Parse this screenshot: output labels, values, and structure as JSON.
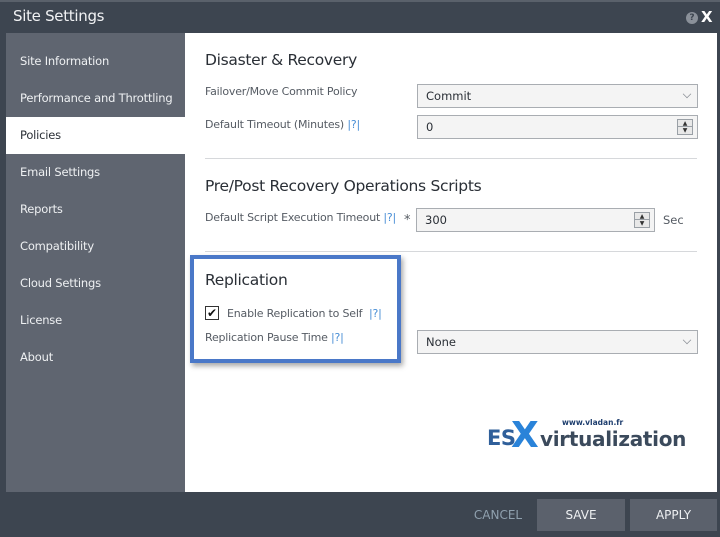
{
  "window": {
    "title": "Site Settings",
    "help_icon": "?",
    "close_icon": "X"
  },
  "sidebar": {
    "items": [
      {
        "label": "Site Information"
      },
      {
        "label": "Performance and Throttling"
      },
      {
        "label": "Policies",
        "active": true
      },
      {
        "label": "Email Settings"
      },
      {
        "label": "Reports"
      },
      {
        "label": "Compatibility"
      },
      {
        "label": "Cloud Settings"
      },
      {
        "label": "License"
      },
      {
        "label": "About"
      }
    ]
  },
  "sections": {
    "disaster_recovery": {
      "title": "Disaster & Recovery",
      "commit_policy_label": "Failover/Move Commit Policy",
      "commit_policy_value": "Commit",
      "default_timeout_label": "Default Timeout (Minutes)",
      "default_timeout_help": "|?|",
      "default_timeout_value": "0"
    },
    "scripts": {
      "title": "Pre/Post Recovery Operations Scripts",
      "exec_timeout_label": "Default Script Execution Timeout",
      "exec_timeout_help": "|?|",
      "required_marker": "*",
      "exec_timeout_value": "300",
      "exec_timeout_unit": "Sec"
    },
    "replication": {
      "title": "Replication",
      "enable_self_label": "Enable Replication to Self",
      "enable_self_help": "|?|",
      "enable_self_checked": true,
      "check_glyph": "✔",
      "pause_time_label": "Replication Pause Time",
      "pause_time_help": "|?|",
      "pause_time_value": "None"
    }
  },
  "watermark": {
    "url": "www.vladan.fr",
    "es": "ES",
    "x": "X",
    "virtualization": "virtualization"
  },
  "footer": {
    "cancel_label": "CANCEL",
    "save_label": "SAVE",
    "apply_label": "APPLY"
  },
  "colors": {
    "accent_highlight": "#4a78c8",
    "help_link": "#4a8fd6",
    "chrome_bg": "#3d4550",
    "sidebar_bg": "#5f6570"
  }
}
